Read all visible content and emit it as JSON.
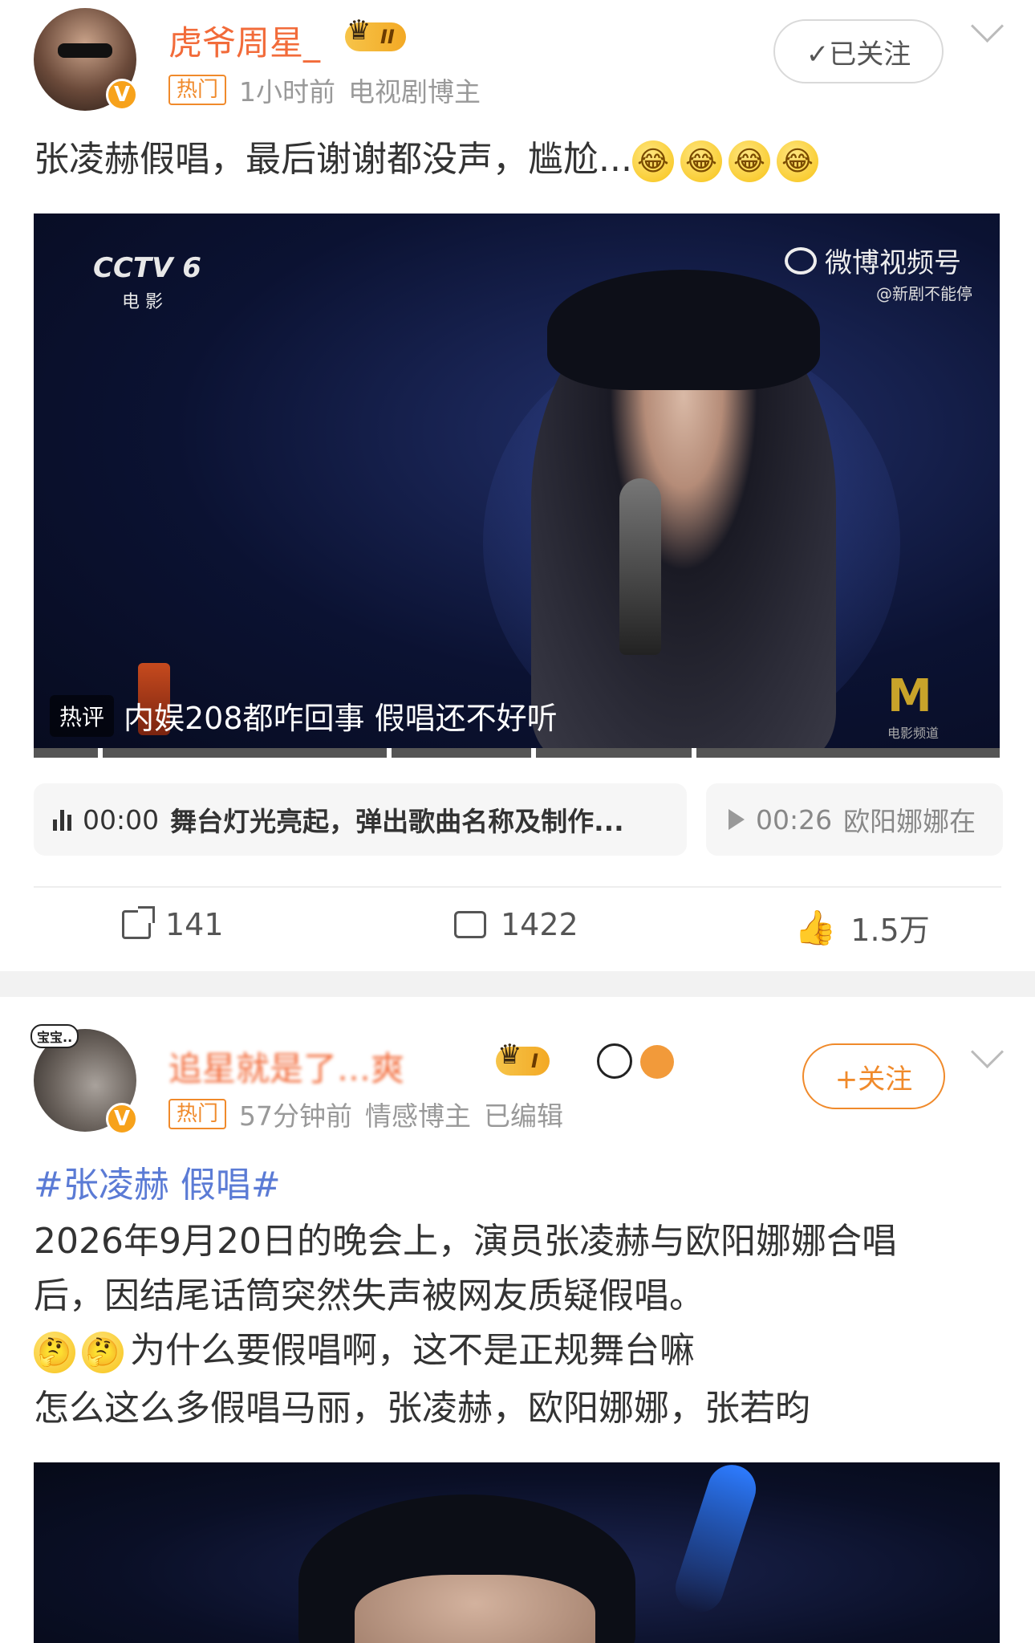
{
  "post1": {
    "username": "虎爷周星_",
    "badge_level": "II",
    "hot_tag": "热门",
    "time": "1小时前",
    "role": "电视剧博主",
    "follow_label": "✓已关注",
    "text": "张凌赫假唱，最后谢谢都没声，尴尬...",
    "video": {
      "channel_logo": "CCTV 6",
      "channel_sub": "电 影",
      "watermark": "微博视频号",
      "watermark_handle": "@新剧不能停",
      "hot_comment_tag": "热评",
      "hot_comment": "内娱208都咋回事 假唱还不好听",
      "corner_logo": "电影频道"
    },
    "chapters": [
      {
        "time": "00:00",
        "label": "舞台灯光亮起，弹出歌曲名称及制作..."
      },
      {
        "time": "00:26",
        "label": "欧阳娜娜在"
      }
    ],
    "actions": {
      "share": "141",
      "comment": "1422",
      "like": "1.5万"
    }
  },
  "post2": {
    "username": "追星就是了…爽",
    "badge_level": "I",
    "avatar_label": "宝宝..",
    "hot_tag": "热门",
    "time": "57分钟前",
    "role": "情感博主",
    "edited": "已编辑",
    "follow_label": "+关注",
    "hashtag": "#张凌赫 假唱#",
    "lines": [
      "2026年9月20日的晚会上，演员张凌赫与欧阳娜娜合唱",
      "后，因结尾话筒突然失声被网友质疑假唱。",
      "为什么要假唱啊，这不是正规舞台嘛",
      "怎么这么多假唱马丽，张凌赫，欧阳娜娜，张若昀"
    ]
  },
  "colors": {
    "accent_orange": "#f26b3a",
    "link_blue": "#5b7bd5",
    "badge_gold": "#f3a925"
  }
}
